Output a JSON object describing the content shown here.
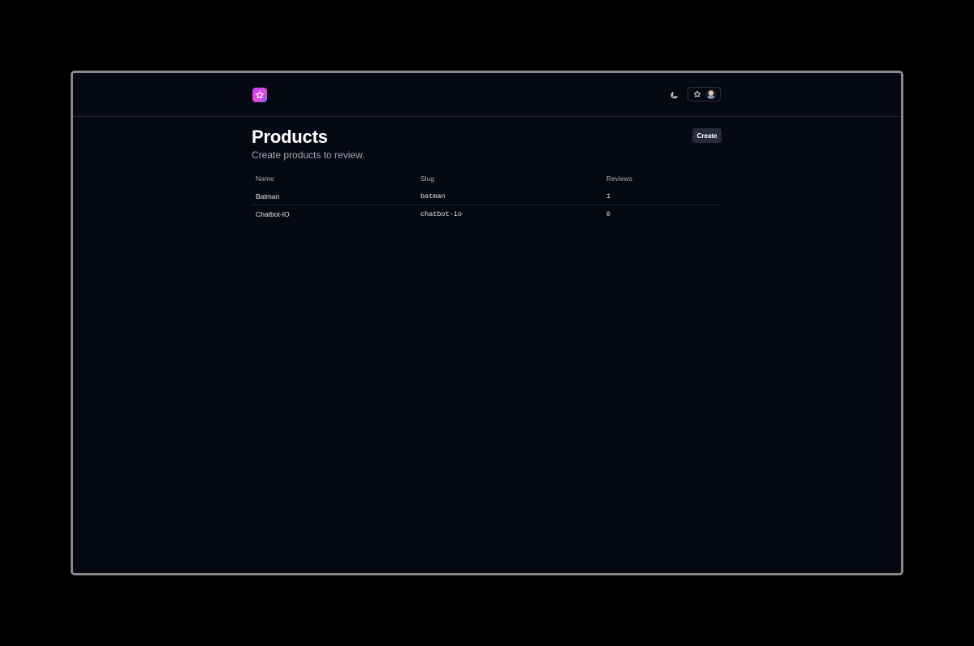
{
  "header": {
    "logo_icon": "star-icon",
    "theme_icon": "moon-icon",
    "favorites_icon": "star-outline-icon"
  },
  "page": {
    "title": "Products",
    "subtitle": "Create products to review.",
    "create_label": "Create"
  },
  "table": {
    "columns": [
      "Name",
      "Slug",
      "Reviews"
    ],
    "rows": [
      {
        "name": "Batman",
        "slug": "batman",
        "reviews": "1"
      },
      {
        "name": "Chatbot-IO",
        "slug": "chatbot-io",
        "reviews": "0"
      }
    ]
  },
  "colors": {
    "background": "#060814",
    "accent": "#b84cf5",
    "button_bg": "#262c3a"
  }
}
